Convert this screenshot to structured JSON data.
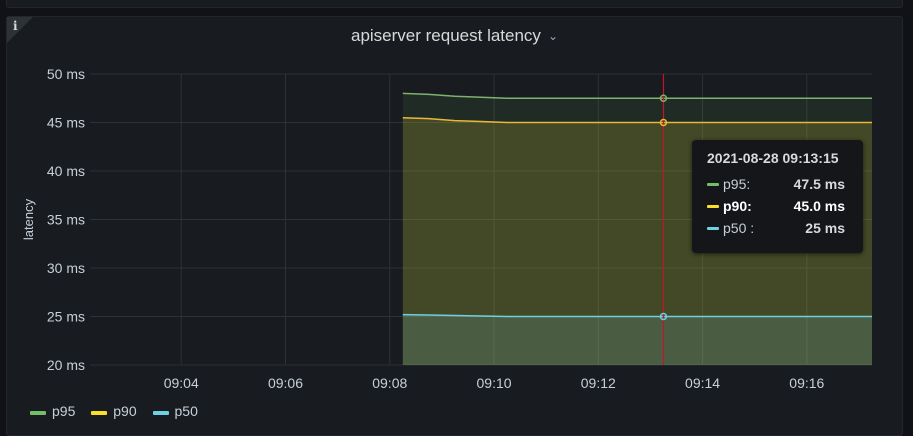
{
  "panel": {
    "title": "apiserver request latency",
    "info_icon": "info-icon",
    "menu_icon": "chevron-down-icon"
  },
  "colors": {
    "p95": "#73bf69",
    "p90": "#fade2a",
    "p50": "#5794f2",
    "p95_line": "#7eb26d",
    "p90_line": "#eab839",
    "p50_line": "#6ed0e0",
    "cursor": "#c4162a"
  },
  "tooltip": {
    "time": "2021-08-28 09:13:15",
    "rows": [
      {
        "name": "p95:",
        "value": "47.5 ms"
      },
      {
        "name": "p90:",
        "value": "45.0 ms"
      },
      {
        "name": "p50 :",
        "value": "25 ms"
      }
    ]
  },
  "legend": {
    "items": [
      "p95",
      "p90",
      "p50"
    ]
  },
  "chart_data": {
    "type": "area",
    "title": "apiserver request latency",
    "ylabel": "latency",
    "xlabel": "",
    "y_unit": "ms",
    "ylim": [
      20,
      50
    ],
    "y_ticks": [
      "20 ms",
      "25 ms",
      "30 ms",
      "35 ms",
      "40 ms",
      "45 ms",
      "50 ms"
    ],
    "y_tick_values": [
      20,
      25,
      30,
      35,
      40,
      45,
      50
    ],
    "x_ticks": [
      "09:04",
      "09:06",
      "09:08",
      "09:10",
      "09:12",
      "09:14",
      "09:16"
    ],
    "xlim": [
      "09:02:15",
      "09:17:15"
    ],
    "grid": true,
    "legend_position": "bottom-left",
    "x": [
      "09:08:15",
      "09:08:45",
      "09:09:15",
      "09:09:45",
      "09:10:15",
      "09:11:15",
      "09:12:15",
      "09:13:15",
      "09:14:15",
      "09:15:15",
      "09:16:15",
      "09:17:15"
    ],
    "series": [
      {
        "name": "p95",
        "values": [
          48.0,
          47.9,
          47.7,
          47.6,
          47.5,
          47.5,
          47.5,
          47.5,
          47.5,
          47.5,
          47.5,
          47.5
        ]
      },
      {
        "name": "p90",
        "values": [
          45.5,
          45.4,
          45.2,
          45.1,
          45.0,
          45.0,
          45.0,
          45.0,
          45.0,
          45.0,
          45.0,
          45.0
        ]
      },
      {
        "name": "p50",
        "values": [
          25.2,
          25.15,
          25.1,
          25.05,
          25.0,
          25.0,
          25.0,
          25.0,
          25.0,
          25.0,
          25.0,
          25.0
        ]
      }
    ],
    "cursor_x": "09:13:15"
  }
}
